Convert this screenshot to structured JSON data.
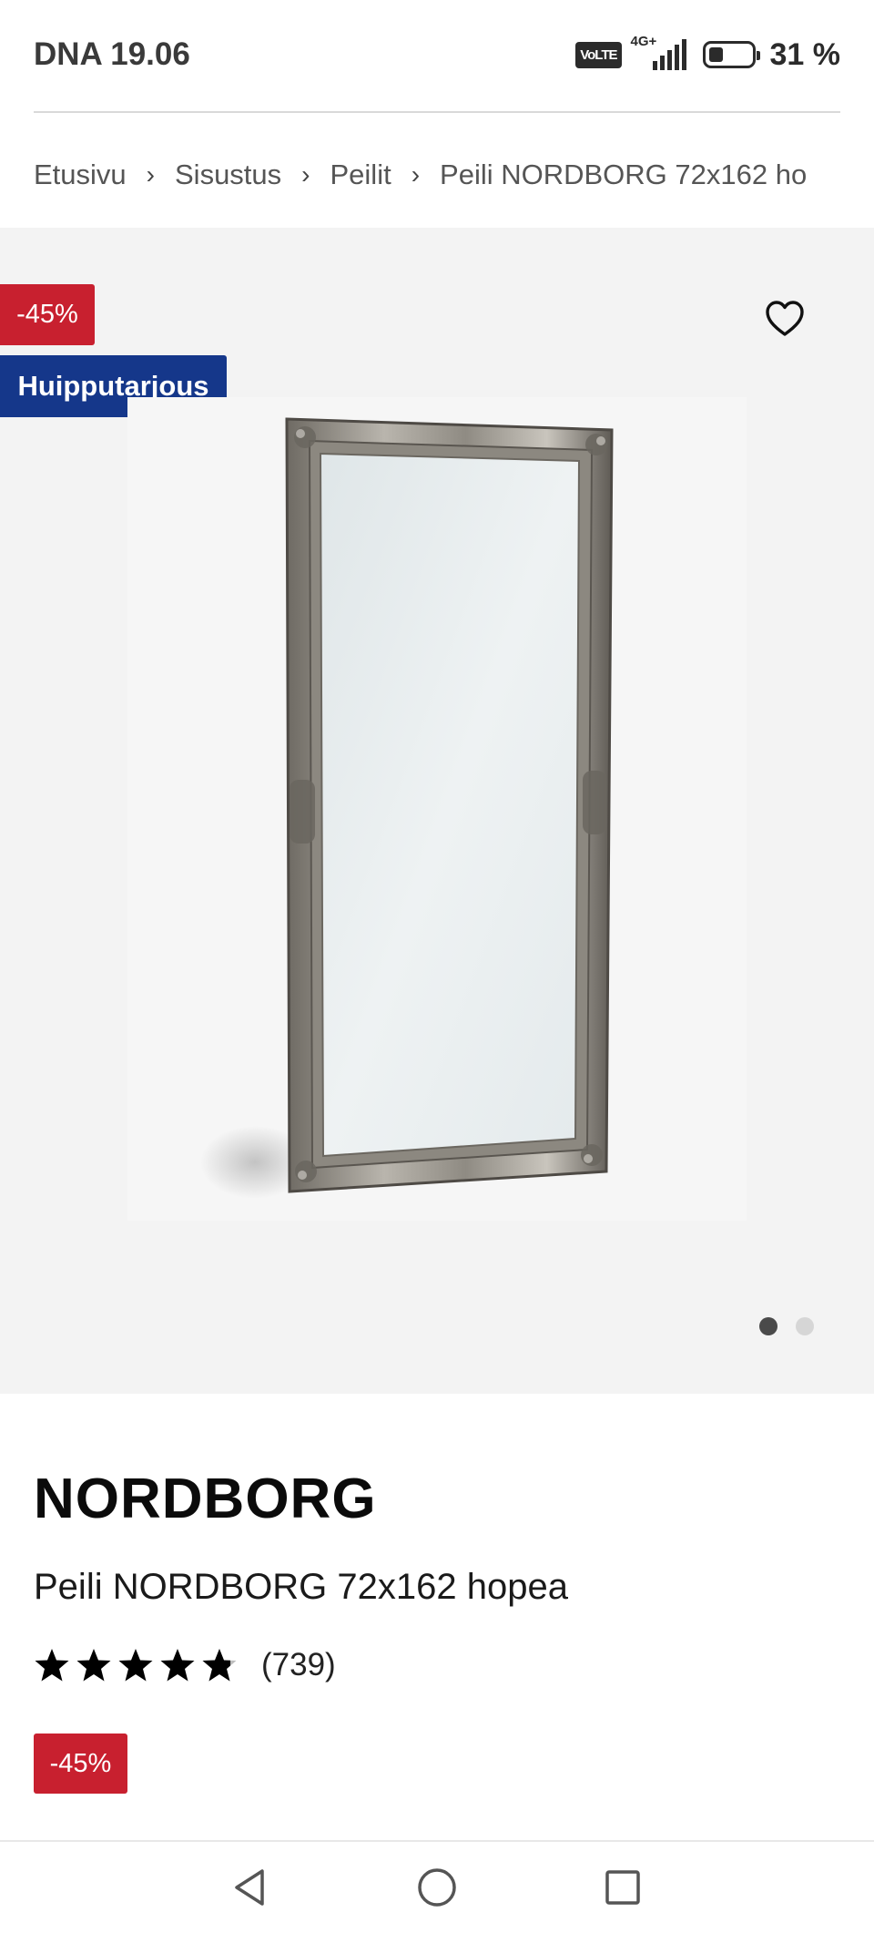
{
  "status_bar": {
    "carrier_time": "DNA 19.06",
    "volte_label": "VoLTE",
    "network_label": "4G+",
    "battery_percent": "31 %",
    "battery_level": 0.31
  },
  "breadcrumb": {
    "items": [
      "Etusivu",
      "Sisustus",
      "Peilit",
      "Peili NORDBORG 72x162 ho"
    ]
  },
  "hero": {
    "discount_badge": "-45%",
    "offer_badge": "Huipputarjous",
    "favorite_icon": "heart-outline-icon",
    "image_description_icon": "product-image",
    "carousel": {
      "count": 2,
      "active_index": 0
    }
  },
  "product": {
    "brand": "NORDBORG",
    "name": "Peili NORDBORG 72x162 hopea",
    "rating_value": 4.8,
    "rating_max": 5,
    "review_count": "(739)",
    "price_badge": "-45%"
  },
  "navbar": {
    "back_icon": "triangle-back-icon",
    "home_icon": "circle-home-icon",
    "recents_icon": "square-recents-icon"
  },
  "colors": {
    "badge_red": "#c8202f",
    "badge_blue": "#15378a",
    "hero_bg": "#f3f3f3"
  }
}
